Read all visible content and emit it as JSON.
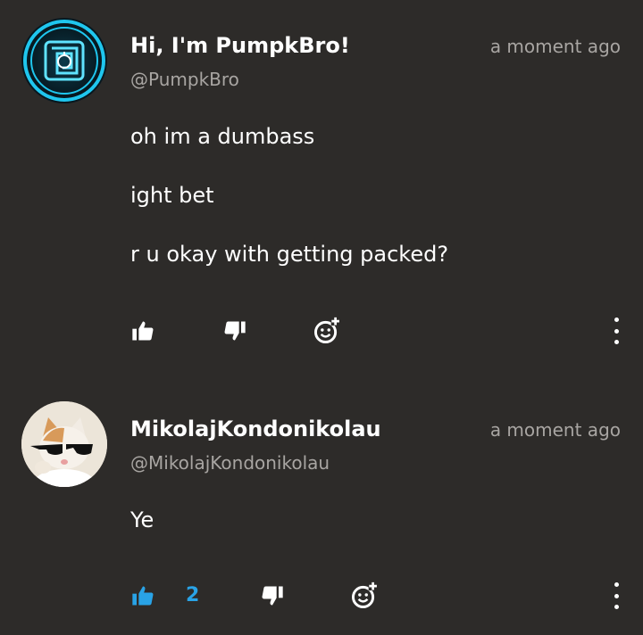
{
  "comments": [
    {
      "name": "Hi, I'm PumpkBro!",
      "handle": "@PumpkBro",
      "time": "a moment ago",
      "lines": [
        "oh im a dumbass",
        "ight bet",
        "r u okay with getting packed?"
      ],
      "avatar_icon": "pumpkin-maze-logo-icon",
      "liked": false,
      "like_count": ""
    },
    {
      "name": "MikolajKondonikolau",
      "handle": "@MikolajKondonikolau",
      "time": "a moment ago",
      "lines": [
        "Ye"
      ],
      "avatar_icon": "cat-with-sunglasses-avatar",
      "liked": true,
      "like_count": "2"
    }
  ],
  "colors": {
    "background": "#2d2b29",
    "muted_text": "#a8a5a2",
    "accent_like": "#29a3e6",
    "avatar_ring": "#1fc6ee"
  }
}
